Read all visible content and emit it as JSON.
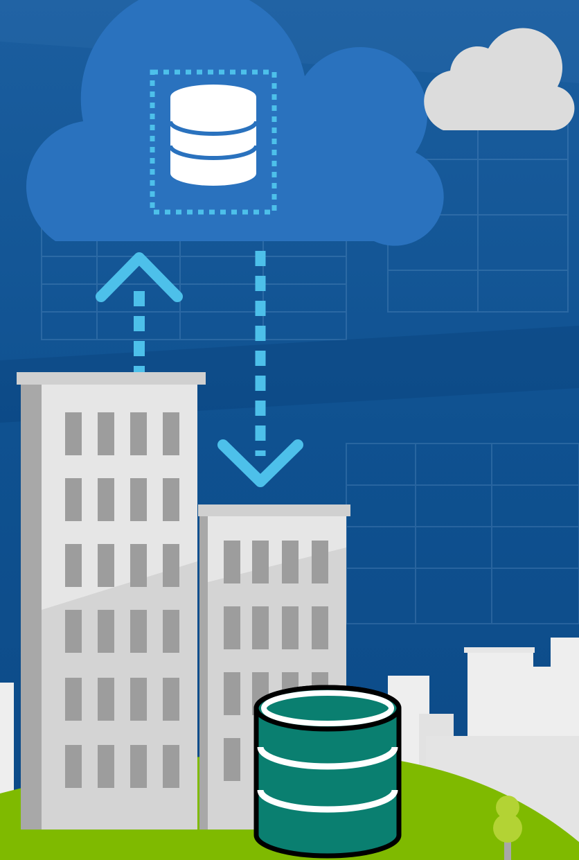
{
  "illustration": {
    "kind": "hybrid-cloud-database-sync",
    "icons": [
      "cloud-database-icon",
      "small-cloud-icon",
      "upload-arrow-icon",
      "download-arrow-icon",
      "office-building-icon",
      "on-premises-database-icon",
      "tree-icon"
    ]
  },
  "colors": {
    "background": "#0d4f90",
    "background_dark": "#0a4581",
    "background_light": "#1a65a8",
    "cloud_main": "#2a72be",
    "cloud_small": "#dcdcdc",
    "dashed_line": "#4dc0ea",
    "database_cloud": "#ffffff",
    "database_onprem": "#0a7f70",
    "database_outline": "#000000",
    "building_light": "#e6e6e6",
    "building_mid": "#d4d4d4",
    "building_shade": "#a8a8a8",
    "building_window": "#9d9d9d",
    "skyline": "#eeeeee",
    "grass": "#7fba00",
    "tree": "#b3d334",
    "tree_trunk": "#a8a8a8"
  }
}
